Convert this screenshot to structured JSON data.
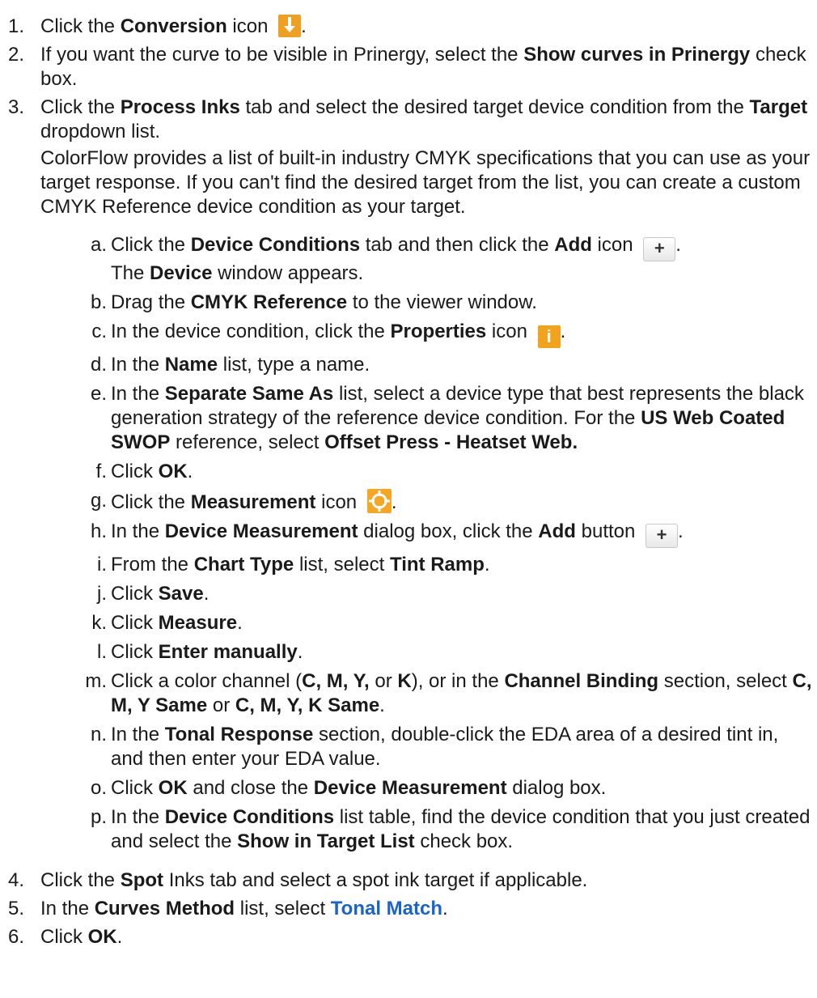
{
  "steps": [
    {
      "num": "1.",
      "p1": "Click the ",
      "b1": "Conversion",
      "p2": " icon",
      "end": ".",
      "icon": "conversion-icon"
    },
    {
      "num": "2.",
      "p1": "If you want the curve to be visible in Prinergy, select the ",
      "b1": "Show curves in Prinergy",
      "p2": " check box."
    },
    {
      "num": "3.",
      "p1": "Click the ",
      "b1": "Process Inks",
      "p2": " tab and select the desired target device condition from the ",
      "b2": "Target",
      "p3": " dropdown list.",
      "note": "ColorFlow provides a list of built-in industry CMYK specifications that you can use as your target response. If you can't find the desired target from the list, you can create a custom CMYK Reference device condition as your target."
    },
    {
      "num": "4.",
      "p1": "Click the ",
      "b1": "Spot",
      "p2": " Inks tab and select a spot ink target if applicable."
    },
    {
      "num": "5.",
      "p1": "In the ",
      "b1": "Curves Method",
      "p2": " list, select ",
      "blue": "Tonal Match",
      "end": "."
    },
    {
      "num": "6.",
      "p1": "Click ",
      "b1": "OK",
      "end": "."
    }
  ],
  "substeps": [
    {
      "num": "a.",
      "p1": "Click the ",
      "b1": "Device Conditions",
      "p2": " tab and then click the ",
      "b2": "Add",
      "p3": " icon",
      "end": ".",
      "line2_b": "The ",
      "line2_bold": "Device",
      "line2_e": " window appears.",
      "icon": "add-icon"
    },
    {
      "num": "b.",
      "p1": " Drag the ",
      "b1": "CMYK Reference",
      "p2": " to the viewer window."
    },
    {
      "num": "c.",
      "p1": "In the device condition, click the ",
      "b1": "Properties",
      "p2": " icon",
      "end": ".",
      "icon": "info-icon",
      "icon_glyph": "i"
    },
    {
      "num": "d.",
      "p1": "In the ",
      "b1": "Name",
      "p2": " list, type a name."
    },
    {
      "num": "e.",
      "p1": "In the ",
      "b1": "Separate Same As",
      "p2": " list, select a device type that best represents the black generation strategy of the reference device condition. For the ",
      "b2": "US Web Coated SWOP",
      "p3": " reference, select ",
      "b3": "Offset Press - Heatset Web."
    },
    {
      "num": "f.",
      "p1": "Click ",
      "b1": "OK",
      "end": "."
    },
    {
      "num": "g.",
      "p1": "Click the ",
      "b1": "Measurement",
      "p2": " icon",
      "end": ".",
      "icon": "target-icon"
    },
    {
      "num": "h.",
      "p1": "In the ",
      "b1": "Device Measurement",
      "p2": " dialog box, click the ",
      "b2": "Add",
      "p3": " button",
      "end": ".",
      "icon": "add-icon"
    },
    {
      "num": "i.",
      "p1": "From the ",
      "b1": "Chart Type",
      "p2": " list, select ",
      "b2": "Tint Ramp",
      "end": "."
    },
    {
      "num": "j.",
      "p1": "Click ",
      "b1": "Save",
      "end": "."
    },
    {
      "num": "k.",
      "p1": "Click ",
      "b1": "Measure",
      "end": "."
    },
    {
      "num": "l.",
      "p1": "Click ",
      "b1": "Enter manually",
      "end": "."
    },
    {
      "num": "m.",
      "p1": "Click a color channel (",
      "b1": "C, M, Y,",
      "p2": " or ",
      "b2": "K",
      "p3": "), or in the ",
      "b3": "Channel Binding",
      "p4": " section, select ",
      "b4": "C, M, Y Same",
      "p5": " or ",
      "b5": "C, M, Y, K Same",
      "end": "."
    },
    {
      "num": "n.",
      "p1": "In the ",
      "b1": "Tonal Response",
      "p2": " section, double-click the EDA area of a desired tint in, and then enter your EDA value."
    },
    {
      "num": "o.",
      "p1": "Click ",
      "b1": "OK",
      "p2": " and close the ",
      "b2": "Device Measurement",
      "p3": " dialog box."
    },
    {
      "num": "p.",
      "p1": "In the ",
      "b1": "Device Conditions",
      "p2": " list table, find the device condition that you just created and select the ",
      "b2": "Show in Target List",
      "p3": " check box."
    }
  ],
  "icon_colors": {
    "conversion": "#f0a020",
    "properties": "#f3a21b",
    "measurement": "#f5a623"
  }
}
